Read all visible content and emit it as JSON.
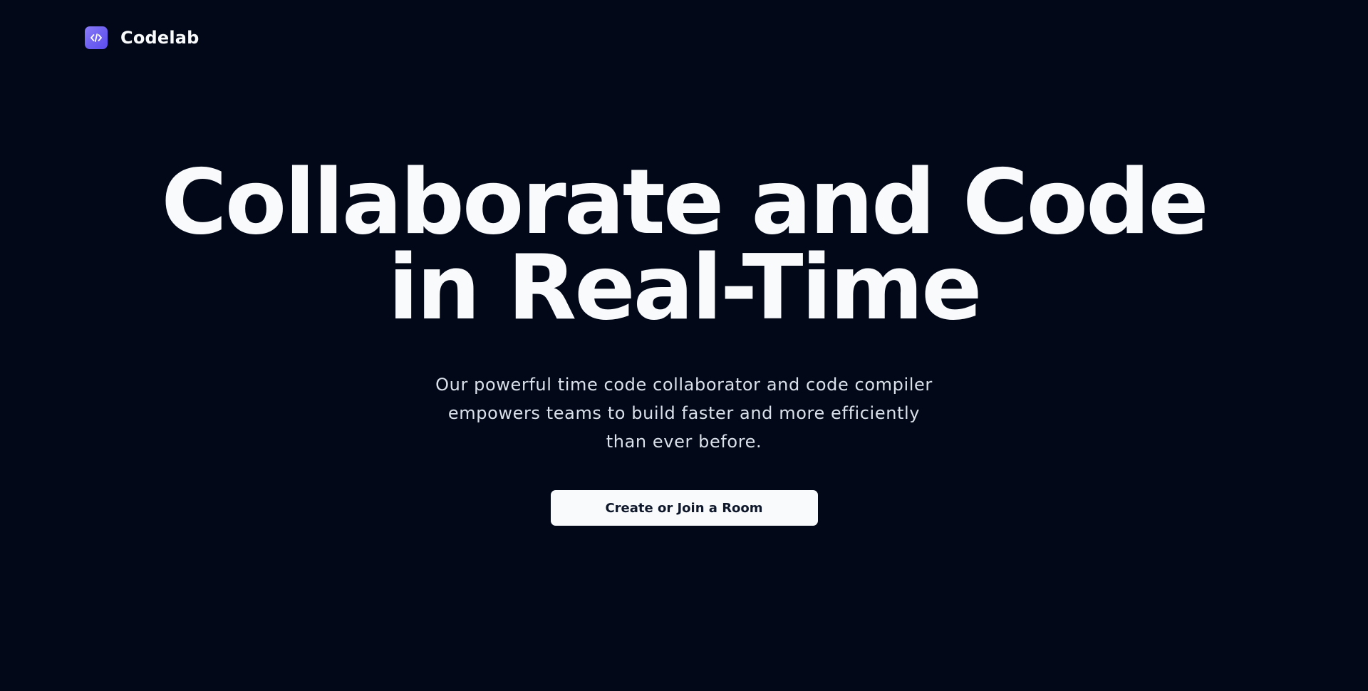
{
  "brand": {
    "name": "Codelab",
    "icon": "code-brackets-icon",
    "accent_color": "#6d5ff0"
  },
  "hero": {
    "headline_line1": "Collaborate and Code",
    "headline_line2": "in Real-Time",
    "subtitle": "Our powerful time code collaborator and code compiler empowers teams to build faster and more efficiently than ever before.",
    "cta_label": "Create or Join a Room"
  },
  "theme": {
    "background": "#020817",
    "text": "#f8fafc",
    "button_background": "#f8fafc",
    "button_text": "#0f172a"
  }
}
